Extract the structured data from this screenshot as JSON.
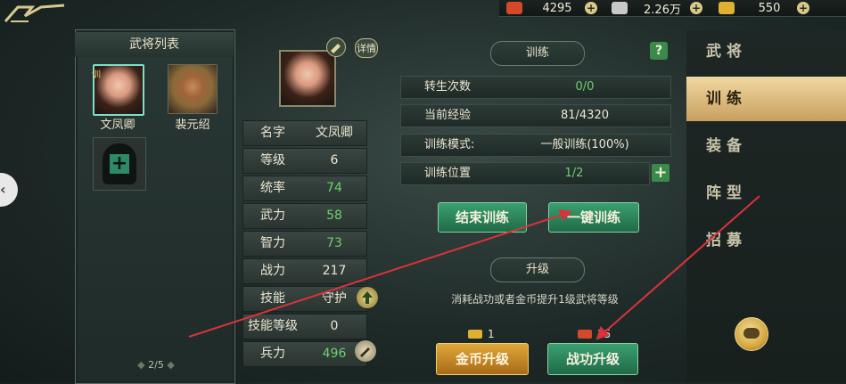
{
  "resources": [
    {
      "icon": "red-gem-icon",
      "value": "4295",
      "color": "#d24a2a"
    },
    {
      "icon": "silver-ingot-icon",
      "value": "2.26万",
      "color": "#c8c8c8"
    },
    {
      "icon": "gold-ingot-icon",
      "value": "550",
      "color": "#e0b030"
    }
  ],
  "left_panel": {
    "title": "武将列表",
    "heroes": [
      {
        "name": "文凤卿",
        "tag": "训"
      },
      {
        "name": "裴元绍"
      }
    ],
    "pager": "2/5"
  },
  "hero": {
    "detail_label": "详情",
    "stats": [
      {
        "label": "名字",
        "value": "文凤卿"
      },
      {
        "label": "等级",
        "value": "6"
      },
      {
        "label": "统率",
        "value": "74"
      },
      {
        "label": "武力",
        "value": "58"
      },
      {
        "label": "智力",
        "value": "73"
      },
      {
        "label": "战力",
        "value": "217"
      },
      {
        "label": "技能",
        "value": "守护"
      },
      {
        "label": "技能等级",
        "value": "0"
      },
      {
        "label": "兵力",
        "value": "496"
      }
    ]
  },
  "training": {
    "title": "训练",
    "help": "?",
    "rows": [
      {
        "label": "转生次数",
        "value": "0/0"
      },
      {
        "label": "当前经验",
        "value": "81/4320"
      },
      {
        "label": "训练模式:",
        "value": "一般训练(100%)"
      },
      {
        "label": "训练位置",
        "value": "1/2"
      }
    ],
    "end_button": "结束训练",
    "one_key_button": "一键训练"
  },
  "upgrade": {
    "title": "升级",
    "desc": "消耗战功或者金币提升1级武将等级",
    "gold_cost": "1",
    "merit_cost": "35",
    "gold_button": "金币升级",
    "merit_button": "战功升级"
  },
  "tabs": [
    {
      "label": "武将",
      "active": false
    },
    {
      "label": "训练",
      "active": true
    },
    {
      "label": "装备",
      "active": false
    },
    {
      "label": "阵型",
      "active": false
    },
    {
      "label": "招募",
      "active": false
    }
  ],
  "annotation_color": "#d8333a"
}
